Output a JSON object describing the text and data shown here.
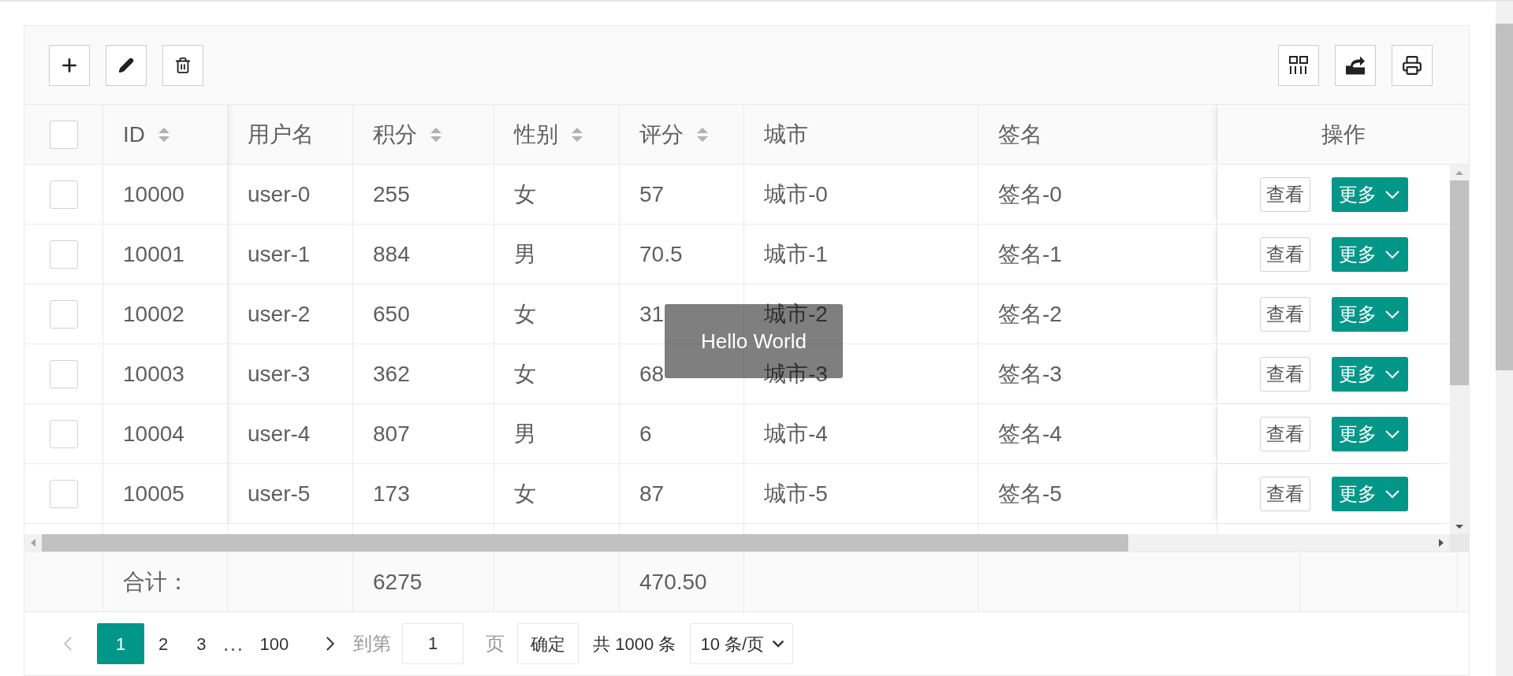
{
  "header_checkbox": {
    "checked": false
  },
  "columns": [
    {
      "label": "ID",
      "sortable": true,
      "total": "合计："
    },
    {
      "label": "用户名",
      "sortable": false
    },
    {
      "label": "积分",
      "sortable": true,
      "total": "6275"
    },
    {
      "label": "性别",
      "sortable": true
    },
    {
      "label": "评分",
      "sortable": true,
      "total": "470.50"
    },
    {
      "label": "城市",
      "sortable": false
    },
    {
      "label": "签名",
      "sortable": false
    }
  ],
  "action_column": {
    "label": "操作"
  },
  "rows": [
    {
      "checked": false,
      "cells": [
        "10000",
        "user-0",
        "255",
        "女",
        "57",
        "城市-0",
        "签名-0"
      ],
      "actions": [
        "查看",
        "更多"
      ]
    },
    {
      "checked": false,
      "cells": [
        "10001",
        "user-1",
        "884",
        "男",
        "70.5",
        "城市-1",
        "签名-1"
      ],
      "actions": [
        "查看",
        "更多"
      ]
    },
    {
      "checked": false,
      "cells": [
        "10002",
        "user-2",
        "650",
        "女",
        "31",
        "城市-2",
        "签名-2"
      ],
      "actions": [
        "查看",
        "更多"
      ]
    },
    {
      "checked": false,
      "cells": [
        "10003",
        "user-3",
        "362",
        "女",
        "68",
        "城市-3",
        "签名-3"
      ],
      "actions": [
        "查看",
        "更多"
      ]
    },
    {
      "checked": false,
      "cells": [
        "10004",
        "user-4",
        "807",
        "男",
        "6",
        "城市-4",
        "签名-4"
      ],
      "actions": [
        "查看",
        "更多"
      ]
    },
    {
      "checked": false,
      "cells": [
        "10005",
        "user-5",
        "173",
        "女",
        "87",
        "城市-5",
        "签名-5"
      ],
      "actions": [
        "查看",
        "更多"
      ]
    }
  ],
  "pagination": {
    "pages": [
      {
        "label": "1",
        "selected": true
      },
      {
        "label": "2",
        "selected": false
      },
      {
        "label": "3",
        "selected": false
      }
    ],
    "ellipsis": "…",
    "last_page": {
      "label": "100",
      "selected": false
    },
    "goto_label": "到第",
    "goto_value": "1",
    "page_suffix": "页",
    "confirm": "确定",
    "total": "共 1000 条",
    "page_size": "10 条/页"
  },
  "tooltip": "Hello World"
}
